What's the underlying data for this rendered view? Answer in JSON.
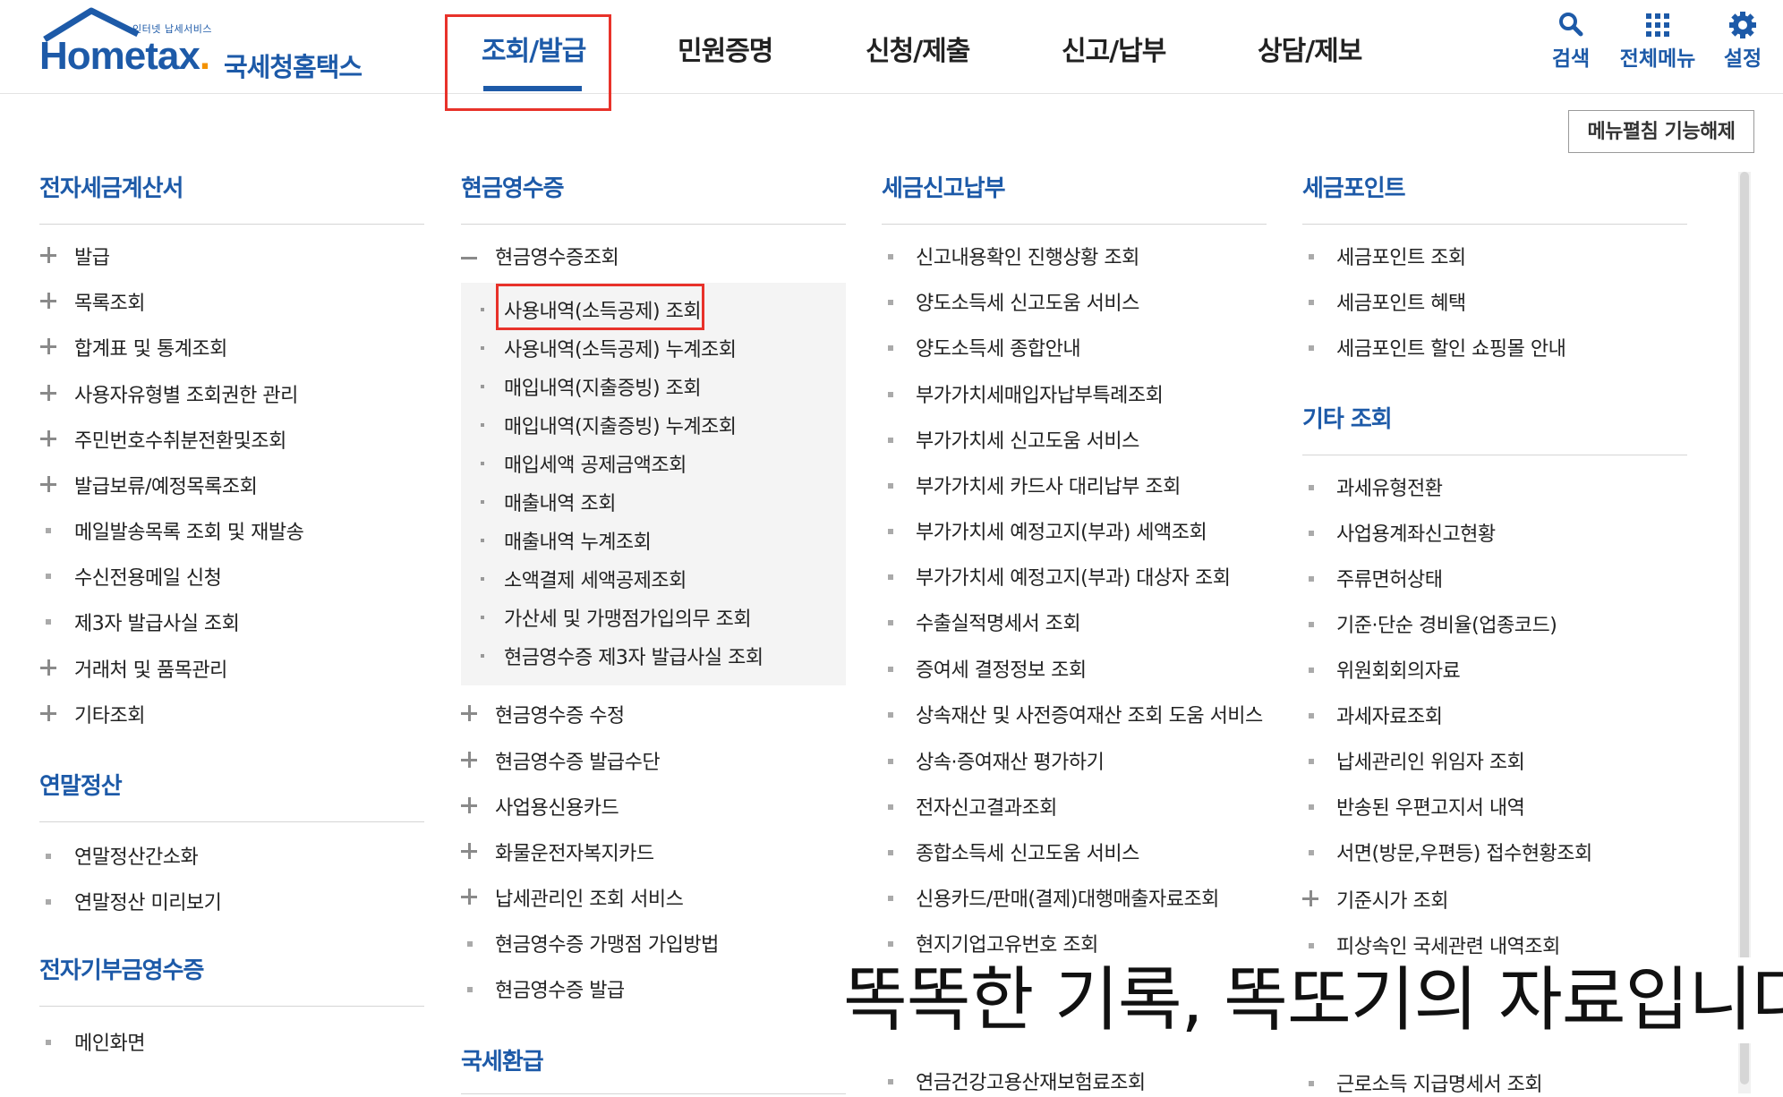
{
  "logo": {
    "small_text": "인터넷 납세서비스",
    "word_main": "Hometax",
    "word_dot": ".",
    "korean_name": "국세청홈택스"
  },
  "nav": [
    {
      "label": "조회/발급",
      "active": true
    },
    {
      "label": "민원증명",
      "active": false
    },
    {
      "label": "신청/제출",
      "active": false
    },
    {
      "label": "신고/납부",
      "active": false
    },
    {
      "label": "상담/제보",
      "active": false
    }
  ],
  "utils": {
    "search": "검색",
    "all_menu": "전체메뉴",
    "settings": "설정"
  },
  "edit_button": "메뉴펼침 기능해제",
  "col1": {
    "sections": [
      {
        "title": "전자세금계산서",
        "items": [
          {
            "label": "발급",
            "icon": "plus"
          },
          {
            "label": "목록조회",
            "icon": "plus"
          },
          {
            "label": "합계표 및 통계조회",
            "icon": "plus"
          },
          {
            "label": "사용자유형별 조회권한 관리",
            "icon": "plus"
          },
          {
            "label": "주민번호수취분전환및조회",
            "icon": "plus"
          },
          {
            "label": "발급보류/예정목록조회",
            "icon": "plus"
          },
          {
            "label": "메일발송목록 조회 및 재발송",
            "icon": "bullet"
          },
          {
            "label": "수신전용메일 신청",
            "icon": "bullet"
          },
          {
            "label": "제3자 발급사실 조회",
            "icon": "bullet"
          },
          {
            "label": "거래처 및 품목관리",
            "icon": "plus"
          },
          {
            "label": "기타조회",
            "icon": "plus"
          }
        ]
      },
      {
        "title": "연말정산",
        "items": [
          {
            "label": "연말정산간소화",
            "icon": "bullet"
          },
          {
            "label": "연말정산 미리보기",
            "icon": "bullet"
          }
        ]
      },
      {
        "title": "전자기부금영수증",
        "items": [
          {
            "label": "메인화면",
            "icon": "bullet"
          }
        ]
      }
    ]
  },
  "col2": {
    "title": "현금영수증",
    "expanded_item": "현금영수증조회",
    "sub_items": [
      "사용내역(소득공제) 조회",
      "사용내역(소득공제) 누계조회",
      "매입내역(지출증빙) 조회",
      "매입내역(지출증빙) 누계조회",
      "매입세액 공제금액조회",
      "매출내역 조회",
      "매출내역 누계조회",
      "소액결제 세액공제조회",
      "가산세 및 가맹점가입의무 조회",
      "현금영수증 제3자 발급사실 조회"
    ],
    "items": [
      {
        "label": "현금영수증 수정",
        "icon": "plus"
      },
      {
        "label": "현금영수증 발급수단",
        "icon": "plus"
      },
      {
        "label": "사업용신용카드",
        "icon": "plus"
      },
      {
        "label": "화물운전자복지카드",
        "icon": "plus"
      },
      {
        "label": "납세관리인 조회 서비스",
        "icon": "plus"
      },
      {
        "label": "현금영수증 가맹점 가입방법",
        "icon": "bullet"
      },
      {
        "label": "현금영수증 발급",
        "icon": "bullet"
      }
    ],
    "section2_title": "국세환급"
  },
  "col3": {
    "title": "세금신고납부",
    "items": [
      "신고내용확인 진행상황 조회",
      "양도소득세 신고도움 서비스",
      "양도소득세 종합안내",
      "부가가치세매입자납부특례조회",
      "부가가치세 신고도움 서비스",
      "부가가치세 카드사 대리납부 조회",
      "부가가치세 예정고지(부과) 세액조회",
      "부가가치세 예정고지(부과) 대상자 조회",
      "수출실적명세서 조회",
      "증여세 결정정보 조회",
      "상속재산 및 사전증여재산 조회 도움 서비스",
      "상속·증여재산 평가하기",
      "전자신고결과조회",
      "종합소득세 신고도움 서비스",
      "신용카드/판매(결제)대행매출자료조회",
      "현지기업고유번호 조회",
      "연금건강고용산재보험료조회"
    ]
  },
  "col4": {
    "sections": [
      {
        "title": "세금포인트",
        "items": [
          {
            "label": "세금포인트 조회",
            "icon": "bullet"
          },
          {
            "label": "세금포인트 혜택",
            "icon": "bullet"
          },
          {
            "label": "세금포인트 할인 쇼핑몰 안내",
            "icon": "bullet"
          }
        ]
      },
      {
        "title": "기타 조회",
        "items": [
          {
            "label": "과세유형전환",
            "icon": "bullet"
          },
          {
            "label": "사업용계좌신고현황",
            "icon": "bullet"
          },
          {
            "label": "주류면허상태",
            "icon": "bullet"
          },
          {
            "label": "기준·단순 경비율(업종코드)",
            "icon": "bullet"
          },
          {
            "label": "위원회회의자료",
            "icon": "bullet"
          },
          {
            "label": "과세자료조회",
            "icon": "bullet"
          },
          {
            "label": "납세관리인 위임자 조회",
            "icon": "bullet"
          },
          {
            "label": "반송된 우편고지서 내역",
            "icon": "bullet"
          },
          {
            "label": "서면(방문,우편등) 접수현황조회",
            "icon": "bullet"
          },
          {
            "label": "기준시가 조회",
            "icon": "plus"
          },
          {
            "label": "피상속인 국세관련 내역조회",
            "icon": "bullet"
          },
          {
            "label": "근로소득 지급명세서 조회",
            "icon": "bullet"
          }
        ]
      }
    ]
  },
  "caption": "똑똑한 기록, 똑또기의 자료입니다",
  "colors": {
    "brand_blue": "#1d5aa8",
    "highlight_red": "#e8322a",
    "accent_orange": "#f39200"
  }
}
